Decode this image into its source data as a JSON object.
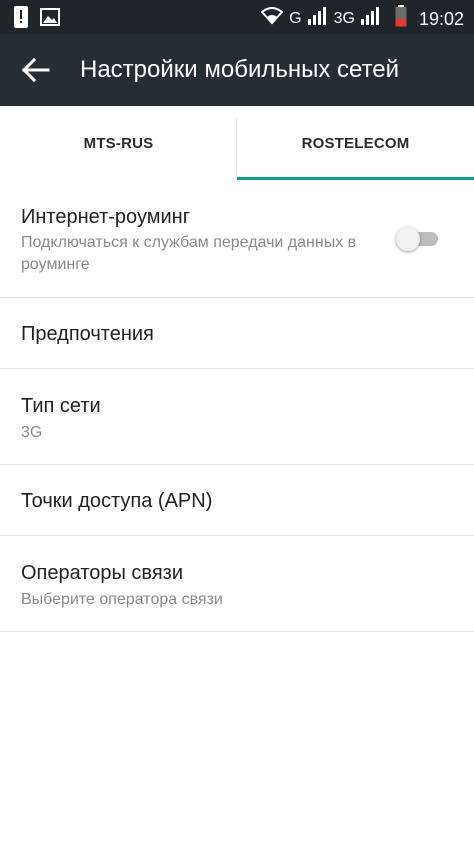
{
  "status_bar": {
    "network_g": "G",
    "network_3g": "3G",
    "time": "19:02"
  },
  "app_bar": {
    "title": "Настройки мобильных сетей"
  },
  "tabs": [
    {
      "label": "MTS-RUS",
      "selected": false
    },
    {
      "label": "ROSTELECOM",
      "selected": true
    }
  ],
  "accent_color": "#0f9b8e",
  "settings": {
    "roaming": {
      "title": "Интернет-роуминг",
      "subtitle": "Подключаться к службам передачи данных в роуминге",
      "toggle_on": false
    },
    "preferences": {
      "title": "Предпочтения"
    },
    "network_type": {
      "title": "Тип сети",
      "subtitle": "3G"
    },
    "apn": {
      "title": "Точки доступа (APN)"
    },
    "operators": {
      "title": "Операторы связи",
      "subtitle": "Выберите оператора связи"
    }
  }
}
